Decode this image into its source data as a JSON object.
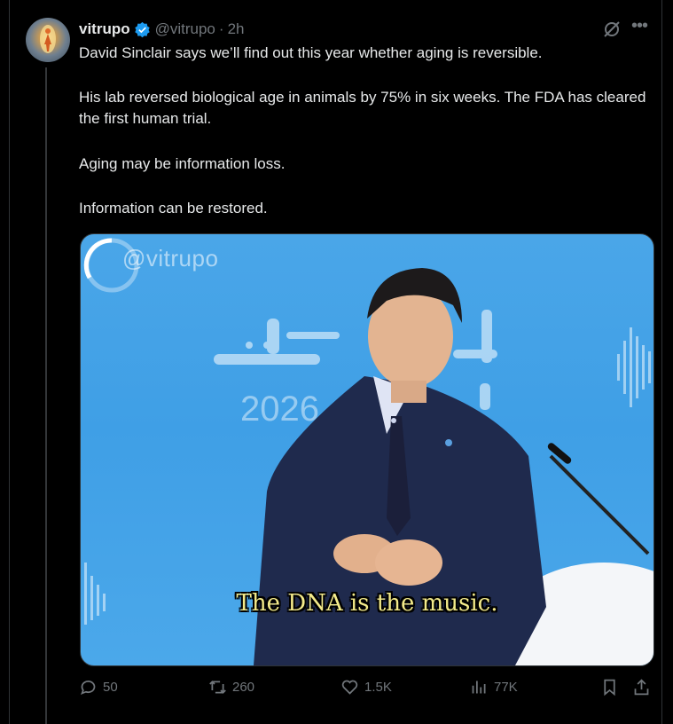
{
  "tweet": {
    "author_name": "vitrupo",
    "handle": "@vitrupo",
    "separator": "·",
    "time": "2h",
    "paragraphs": [
      "David Sinclair says we’ll find out this year whether aging is reversible.",
      "His lab reversed biological age in animals by 75% in six weeks. The FDA has cleared the first human trial.",
      "Aging may be information loss.",
      "Information can be restored."
    ]
  },
  "media": {
    "watermark": "@vitrupo",
    "caption": "The DNA is the music.",
    "background_text": "2026"
  },
  "actions": {
    "replies": "50",
    "reposts": "260",
    "likes": "1.5K",
    "views": "77K"
  },
  "colors": {
    "background": "#000000",
    "text": "#e7e9ea",
    "muted": "#71767b",
    "verified": "#1d9bf0",
    "stage_blue": "#4aa6e8",
    "caption": "#f3ea8a"
  },
  "icons": [
    "verified-badge-icon",
    "grok-icon",
    "more-icon",
    "reply-icon",
    "repost-icon",
    "like-icon",
    "views-icon",
    "bookmark-icon",
    "share-icon"
  ]
}
